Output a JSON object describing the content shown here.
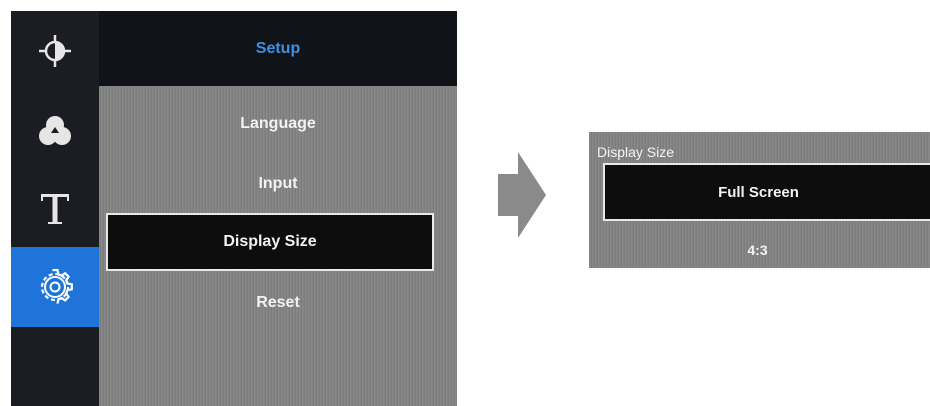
{
  "osd": {
    "header": "Setup",
    "sidebar": [
      {
        "icon": "brightness-icon"
      },
      {
        "icon": "color-icon"
      },
      {
        "icon": "text-icon"
      },
      {
        "icon": "gear-icon",
        "selected": true
      }
    ],
    "menu": [
      {
        "label": "Language"
      },
      {
        "label": "Input"
      },
      {
        "label": "Display Size",
        "selected": true
      },
      {
        "label": "Reset"
      }
    ]
  },
  "arrow": {
    "icon": "arrow-right-icon"
  },
  "submenu": {
    "title": "Display Size",
    "options": [
      {
        "label": "Full Screen",
        "selected": true
      },
      {
        "label": "4:3"
      }
    ]
  },
  "colors": {
    "sidebar_bg": "#1b1d22",
    "header_bg": "#101419",
    "accent_blue": "#1f74da",
    "header_text": "#3f8fe6",
    "panel_gray": "#838383",
    "selection_bg": "#0d0d0d"
  }
}
